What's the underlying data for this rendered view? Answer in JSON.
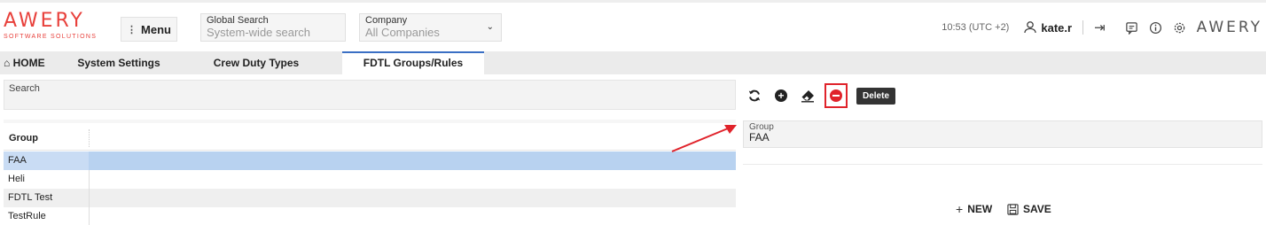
{
  "header": {
    "logo_text": "AWERY",
    "logo_subtitle": "SOFTWARE SOLUTIONS",
    "menu_label": "Menu",
    "global_search": {
      "label": "Global Search",
      "placeholder": "System-wide search"
    },
    "company": {
      "label": "Company",
      "value": "All Companies"
    },
    "time": "10:53 (UTC +2)",
    "username": "kate.r",
    "logo_small": "AWERY"
  },
  "tabs": [
    {
      "label": "HOME",
      "icon": "home-icon"
    },
    {
      "label": "System Settings"
    },
    {
      "label": "Crew Duty Types"
    },
    {
      "label": "FDTL Groups/Rules",
      "active": true
    }
  ],
  "left_pane": {
    "search_label": "Search",
    "grid": {
      "columns": [
        "Group"
      ],
      "rows": [
        "FAA",
        "Heli",
        "FDTL Test",
        "TestRule"
      ],
      "selected_row": "FAA"
    }
  },
  "right_pane": {
    "toolbar": {
      "buttons": [
        "refresh-icon",
        "add-icon",
        "eraser-icon",
        "delete-icon"
      ],
      "tooltip": "Delete"
    },
    "group_field": {
      "label": "Group",
      "value": "FAA"
    },
    "actions": {
      "new_label": "NEW",
      "save_label": "SAVE"
    }
  },
  "colors": {
    "brand": "#e8413c",
    "selected_row": "#b8d2f0",
    "delete_highlight": "#e0232b",
    "active_tab_border": "#3a6fc4"
  }
}
